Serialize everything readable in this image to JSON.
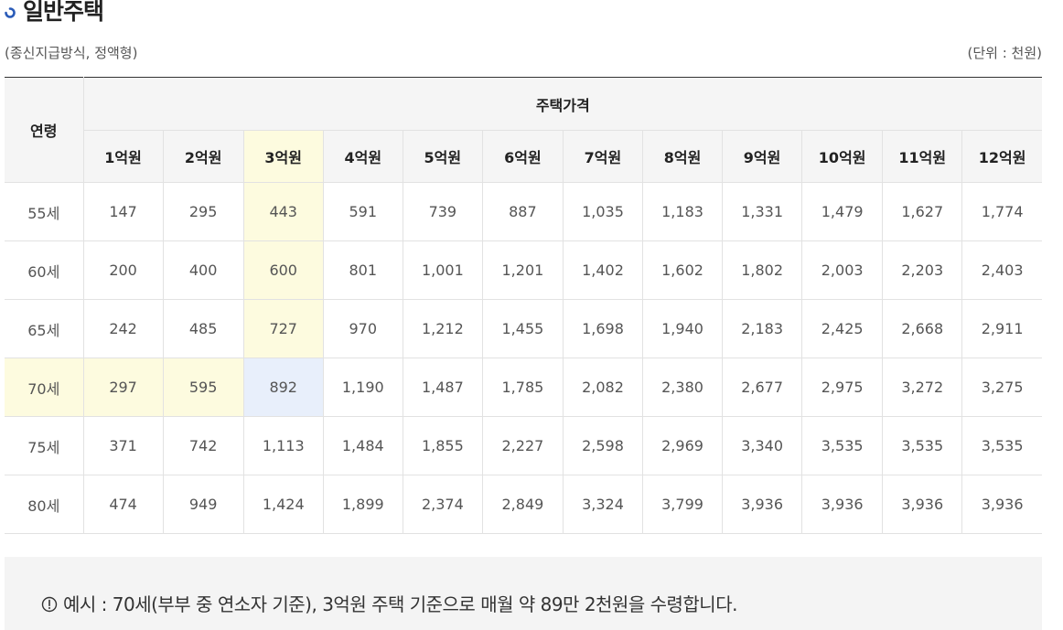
{
  "section": {
    "title": "일반주택",
    "icon": "partial-circle-bullet-icon"
  },
  "meta": {
    "subtitle": "(종신지급방식, 정액형)",
    "unit": "(단위 : 천원)"
  },
  "table": {
    "age_header": "연령",
    "price_header": "주택가격",
    "price_columns": [
      "1억원",
      "2억원",
      "3억원",
      "4억원",
      "5억원",
      "6억원",
      "7억원",
      "8억원",
      "9억원",
      "10억원",
      "11억원",
      "12억원"
    ],
    "rows": [
      {
        "age": "55세",
        "values": [
          "147",
          "295",
          "443",
          "591",
          "739",
          "887",
          "1,035",
          "1,183",
          "1,331",
          "1,479",
          "1,627",
          "1,774"
        ]
      },
      {
        "age": "60세",
        "values": [
          "200",
          "400",
          "600",
          "801",
          "1,001",
          "1,201",
          "1,402",
          "1,602",
          "1,802",
          "2,003",
          "2,203",
          "2,403"
        ]
      },
      {
        "age": "65세",
        "values": [
          "242",
          "485",
          "727",
          "970",
          "1,212",
          "1,455",
          "1,698",
          "1,940",
          "2,183",
          "2,425",
          "2,668",
          "2,911"
        ]
      },
      {
        "age": "70세",
        "values": [
          "297",
          "595",
          "892",
          "1,190",
          "1,487",
          "1,785",
          "2,082",
          "2,380",
          "2,677",
          "2,975",
          "3,272",
          "3,275"
        ]
      },
      {
        "age": "75세",
        "values": [
          "371",
          "742",
          "1,113",
          "1,484",
          "1,855",
          "2,227",
          "2,598",
          "2,969",
          "3,340",
          "3,535",
          "3,535",
          "3,535"
        ]
      },
      {
        "age": "80세",
        "values": [
          "474",
          "949",
          "1,424",
          "1,899",
          "2,374",
          "2,849",
          "3,324",
          "3,799",
          "3,936",
          "3,936",
          "3,936",
          "3,936"
        ]
      }
    ],
    "highlight": {
      "column_label": "3억원",
      "row_label": "70세",
      "yellow": "#fdfbdf",
      "blue": "#e8effb"
    }
  },
  "note": {
    "icon": "exclamation-circle-icon",
    "text": "예시 : 70세(부부 중 연소자 기준), 3억원 주택 기준으로 매월 약 89만 2천원을 수령합니다."
  }
}
